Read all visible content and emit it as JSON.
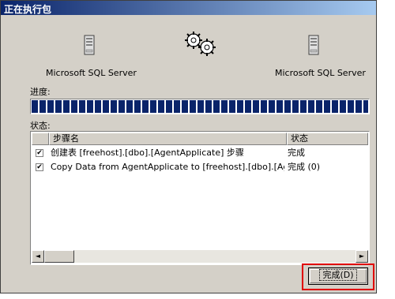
{
  "window": {
    "title": "正在执行包"
  },
  "servers": {
    "source_label": "Microsoft SQL Server",
    "dest_label": "Microsoft SQL Server"
  },
  "progress": {
    "label": "进度:",
    "value": 1.0
  },
  "status": {
    "label": "状态:",
    "columns": [
      "步骤名",
      "状态"
    ],
    "rows": [
      {
        "checked": true,
        "step": "创建表 [freehost].[dbo].[AgentApplicate] 步骤",
        "status": "完成"
      },
      {
        "checked": true,
        "step": "Copy Data from AgentApplicate to [freehost].[dbo].[AgentA...",
        "status": "完成 (0)"
      }
    ]
  },
  "scrollbar": {
    "left_arrow": "◄",
    "right_arrow": "►"
  },
  "done_button": {
    "label": "完成(D)"
  },
  "icons": {
    "server": "server-icon",
    "gears": "gears-icon",
    "check": "✔"
  },
  "colors": {
    "title_start": "#0a246a",
    "title_end": "#a6caf0",
    "progress": "#0a246a",
    "highlight": "#e00000"
  }
}
